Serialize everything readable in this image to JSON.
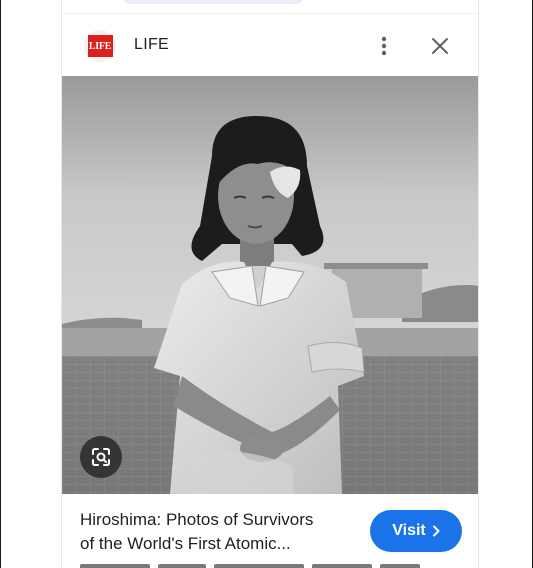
{
  "source": {
    "name": "LIFE",
    "logo_text": "LIFE",
    "logo_color": "#d9211d"
  },
  "actions": {
    "more_icon": "more-vert-icon",
    "close_icon": "close-icon",
    "lens_icon": "lens-search-icon"
  },
  "result": {
    "title_line1": "Hiroshima: Photos of Survivors",
    "title_line2": "of the World's First Atomic...",
    "visit_label": "Visit",
    "visit_icon": "chevron-right-icon",
    "visit_color": "#1a73e8"
  }
}
